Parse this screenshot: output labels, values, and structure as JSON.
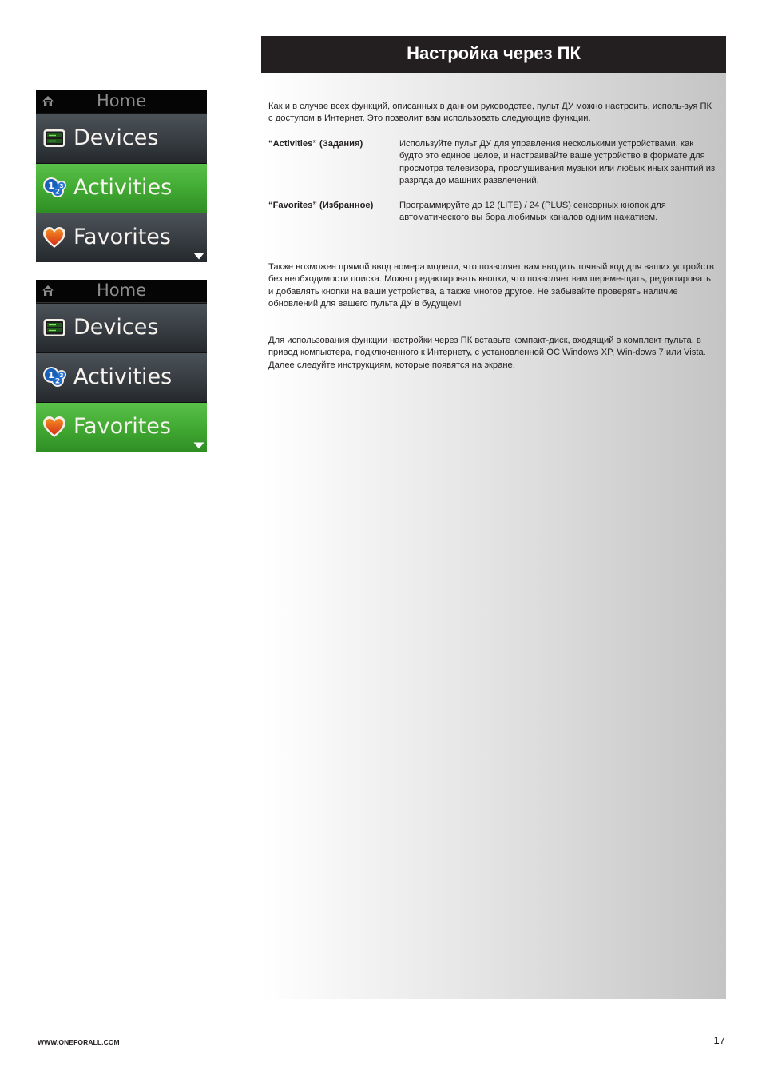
{
  "remote_screens": [
    {
      "header": {
        "title": "Home",
        "icon": "home-icon"
      },
      "items": [
        {
          "label": "Devices",
          "icon": "devices-icon",
          "selected": false
        },
        {
          "label": "Activities",
          "icon": "activities-icon",
          "selected": true
        },
        {
          "label": "Favorites",
          "icon": "heart-icon",
          "selected": false
        }
      ],
      "more_indicator": "triangle-down-icon"
    },
    {
      "header": {
        "title": "Home",
        "icon": "home-icon"
      },
      "items": [
        {
          "label": "Devices",
          "icon": "devices-icon",
          "selected": false
        },
        {
          "label": "Activities",
          "icon": "activities-icon",
          "selected": false
        },
        {
          "label": "Favorites",
          "icon": "heart-icon",
          "selected": true
        }
      ],
      "more_indicator": "triangle-down-icon"
    }
  ],
  "section": {
    "title": "Настройка через ПК",
    "intro": "Как и в случае всех функций, описанных в данном руководстве, пульт ДУ можно настроить, исполь-зуя ПК с доступом в Интернет. Это позволит вам использовать следующие функции.",
    "features": [
      {
        "term": "“Activities” (Задания)",
        "description": "Используйте пульт ДУ для управления несколькими устройствами, как будто это единое целое, и настраивайте ваше устройство в формате для просмотра телевизора, прослушивания музыки или любых иных занятий из разряда до машних развлечений."
      },
      {
        "term": "“Favorites” (Избранное)",
        "description": "Программируйте до 12 (LITE) / 24 (PLUS) сенсорных кнопок для автоматического вы бора любимых каналов одним нажатием."
      }
    ],
    "paragraph_2": "Также возможен прямой ввод номера модели, что позволяет вам вводить точный код для ваших устройств без необходимости поиска. Можно редактировать кнопки, что позволяет вам переме-щать, редактировать и добавлять кнопки на ваши устройства, а также многое другое. Не забывайте проверять наличие обновлений для вашего пульта ДУ в будущем!",
    "paragraph_3": "Для использования функции настройки через ПК вставьте компакт-диск, входящий в комплект пульта, в привод компьютера, подключенного к Интернету, с установленной ОС Windows XP, Win-dows 7 или Vista. Далее следуйте инструкциям, которые появятся на экране."
  },
  "footer": {
    "url": "WWW.ONEFORALL.COM",
    "page_number": "17"
  },
  "colors": {
    "title_bar": "#231f20",
    "selected_item": "#44ad35",
    "item": "#3c4248"
  }
}
